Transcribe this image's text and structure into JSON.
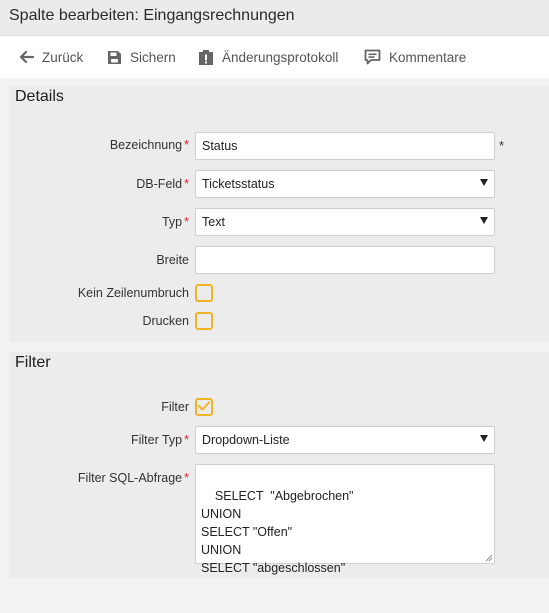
{
  "window": {
    "title": "Spalte bearbeiten: Eingangsrechnungen"
  },
  "toolbar": {
    "back_label": "Zurück",
    "save_label": "Sichern",
    "history_label": "Änderungsprotokoll",
    "comments_label": "Kommentare"
  },
  "details": {
    "heading": "Details",
    "bezeichnung": {
      "label": "Bezeichnung",
      "value": "Status",
      "suffix": "*"
    },
    "dbfeld": {
      "label": "DB-Feld",
      "selected": "Ticketsstatus"
    },
    "typ": {
      "label": "Typ",
      "selected": "Text"
    },
    "breite": {
      "label": "Breite",
      "value": ""
    },
    "kein_zeilenumbruch": {
      "label": "Kein Zeilenumbruch",
      "checked": false
    },
    "drucken": {
      "label": "Drucken",
      "checked": false
    }
  },
  "filter": {
    "heading": "Filter",
    "filter": {
      "label": "Filter",
      "checked": true
    },
    "filter_typ": {
      "label": "Filter Typ",
      "selected": "Dropdown-Liste"
    },
    "sql": {
      "label": "Filter SQL-Abfrage",
      "value": "SELECT  \"Abgebrochen\"\nUNION\nSELECT \"Offen\"\nUNION\nSELECT \"abgeschlossen\""
    }
  },
  "required_marker": "*",
  "colors": {
    "required": "#d9262a",
    "checkbox_border": "#f0b429",
    "panel_bg": "#ececec"
  }
}
